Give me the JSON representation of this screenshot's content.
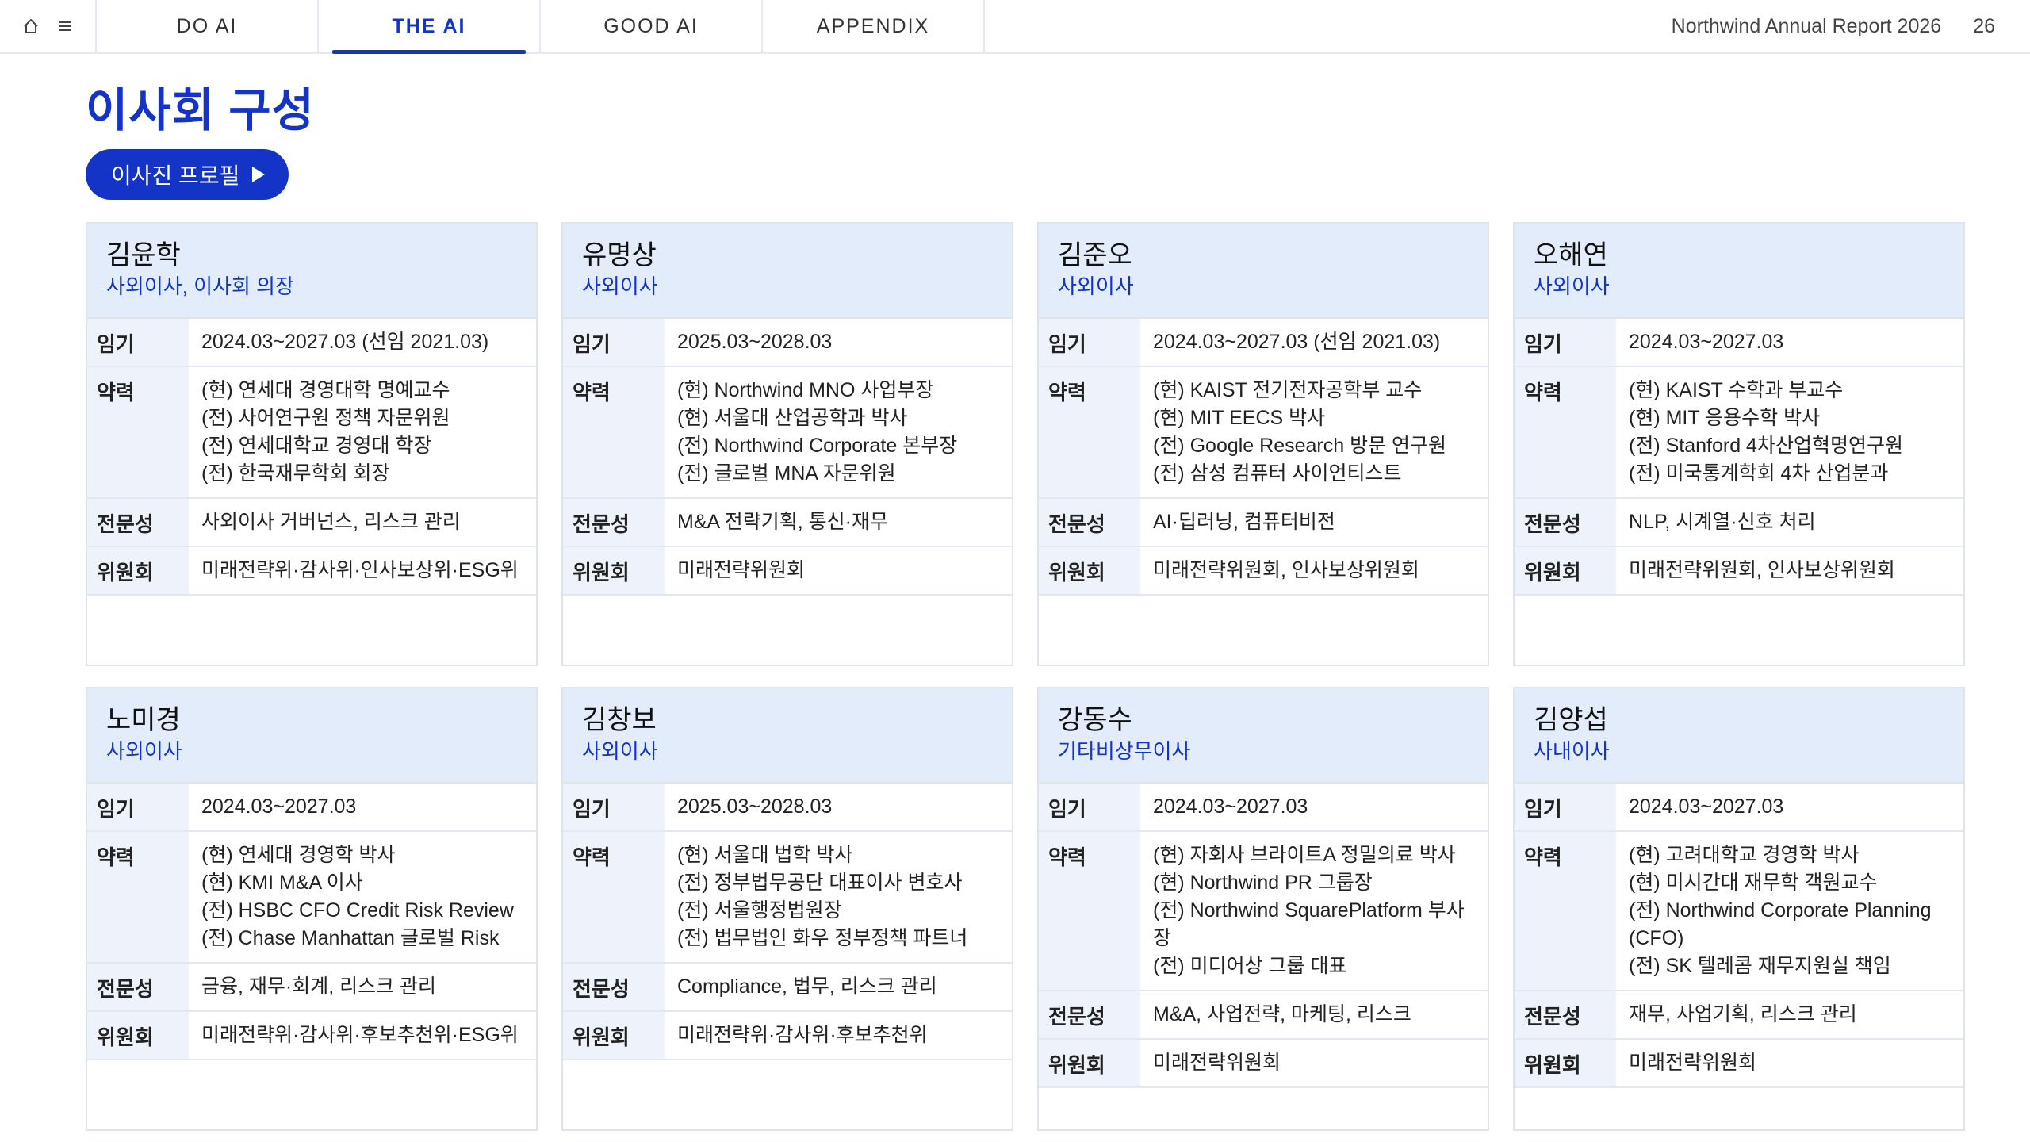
{
  "nav": {
    "tabs": [
      {
        "label": "DO AI",
        "active": false
      },
      {
        "label": "THE AI",
        "active": true
      },
      {
        "label": "GOOD AI",
        "active": false
      },
      {
        "label": "APPENDIX",
        "active": false
      }
    ],
    "report_title": "Northwind Annual Report 2026",
    "page_number": "26",
    "icons": [
      "home-icon",
      "menu-icon"
    ]
  },
  "page": {
    "title": "이사회 구성",
    "profile_button": "이사진 프로필"
  },
  "labels": {
    "term": "임기",
    "career": "약력",
    "expertise": "전문성",
    "committee": "위원회"
  },
  "colors": {
    "accent": "#1434c8",
    "card_header_bg": "#e3ecfa",
    "label_bg": "#eef3fb"
  },
  "directors": [
    {
      "name": "김윤학",
      "role": "사외이사, 이사회 의장",
      "term": "2024.03~2027.03 (선임 2021.03)",
      "career": [
        "(현) 연세대 경영대학 명예교수",
        "(전) 사어연구원 정책 자문위원",
        "(전) 연세대학교 경영대 학장",
        "(전) 한국재무학회 회장"
      ],
      "expertise": "사외이사 거버넌스, 리스크 관리",
      "committee": "미래전략위·감사위·인사보상위·ESG위"
    },
    {
      "name": "유명상",
      "role": "사외이사",
      "term": "2025.03~2028.03",
      "career": [
        "(현) Northwind MNO 사업부장",
        "(현) 서울대 산업공학과 박사",
        "(전) Northwind Corporate 본부장",
        "(전) 글로벌 MNA 자문위원"
      ],
      "expertise": "M&A 전략기획, 통신·재무",
      "committee": "미래전략위원회"
    },
    {
      "name": "김준오",
      "role": "사외이사",
      "term": "2024.03~2027.03 (선임 2021.03)",
      "career": [
        "(현) KAIST 전기전자공학부 교수",
        "(현) MIT EECS 박사",
        "(전) Google Research 방문 연구원",
        "(전) 삼성 컴퓨터 사이언티스트"
      ],
      "expertise": "AI·딥러닝, 컴퓨터비전",
      "committee": "미래전략위원회, 인사보상위원회"
    },
    {
      "name": "오해연",
      "role": "사외이사",
      "term": "2024.03~2027.03",
      "career": [
        "(현) KAIST 수학과 부교수",
        "(현) MIT 응용수학 박사",
        "(전) Stanford 4차산업혁명연구원",
        "(전) 미국통계학회 4차 산업분과"
      ],
      "expertise": "NLP, 시계열·신호 처리",
      "committee": "미래전략위원회, 인사보상위원회"
    },
    {
      "name": "노미경",
      "role": "사외이사",
      "term": "2024.03~2027.03",
      "career": [
        "(현) 연세대 경영학 박사",
        "(현) KMI M&A 이사",
        "(전) HSBC CFO Credit Risk Review",
        "(전) Chase Manhattan 글로벌 Risk"
      ],
      "expertise": "금융, 재무·회계, 리스크 관리",
      "committee": "미래전략위·감사위·후보추천위·ESG위"
    },
    {
      "name": "김창보",
      "role": "사외이사",
      "term": "2025.03~2028.03",
      "career": [
        "(현) 서울대 법학 박사",
        "(전) 정부법무공단 대표이사 변호사",
        "(전) 서울행정법원장",
        "(전) 법무법인 화우 정부정책 파트너"
      ],
      "expertise": "Compliance, 법무, 리스크 관리",
      "committee": "미래전략위·감사위·후보추천위"
    },
    {
      "name": "강동수",
      "role": "기타비상무이사",
      "term": "2024.03~2027.03",
      "career": [
        "(현) 자회사 브라이트A 정밀의료 박사",
        "(현) Northwind PR 그룹장",
        "(전) Northwind SquarePlatform 부사장",
        "(전) 미디어상 그룹 대표"
      ],
      "expertise": "M&A, 사업전략, 마케팅, 리스크",
      "committee": "미래전략위원회"
    },
    {
      "name": "김양섭",
      "role": "사내이사",
      "term": "2024.03~2027.03",
      "career": [
        "(현) 고려대학교 경영학 박사",
        "(현) 미시간대 재무학 객원교수",
        "(전) Northwind Corporate Planning (CFO)",
        "(전) SK 텔레콤 재무지원실 책임"
      ],
      "expertise": "재무, 사업기획, 리스크 관리",
      "committee": "미래전략위원회"
    }
  ]
}
